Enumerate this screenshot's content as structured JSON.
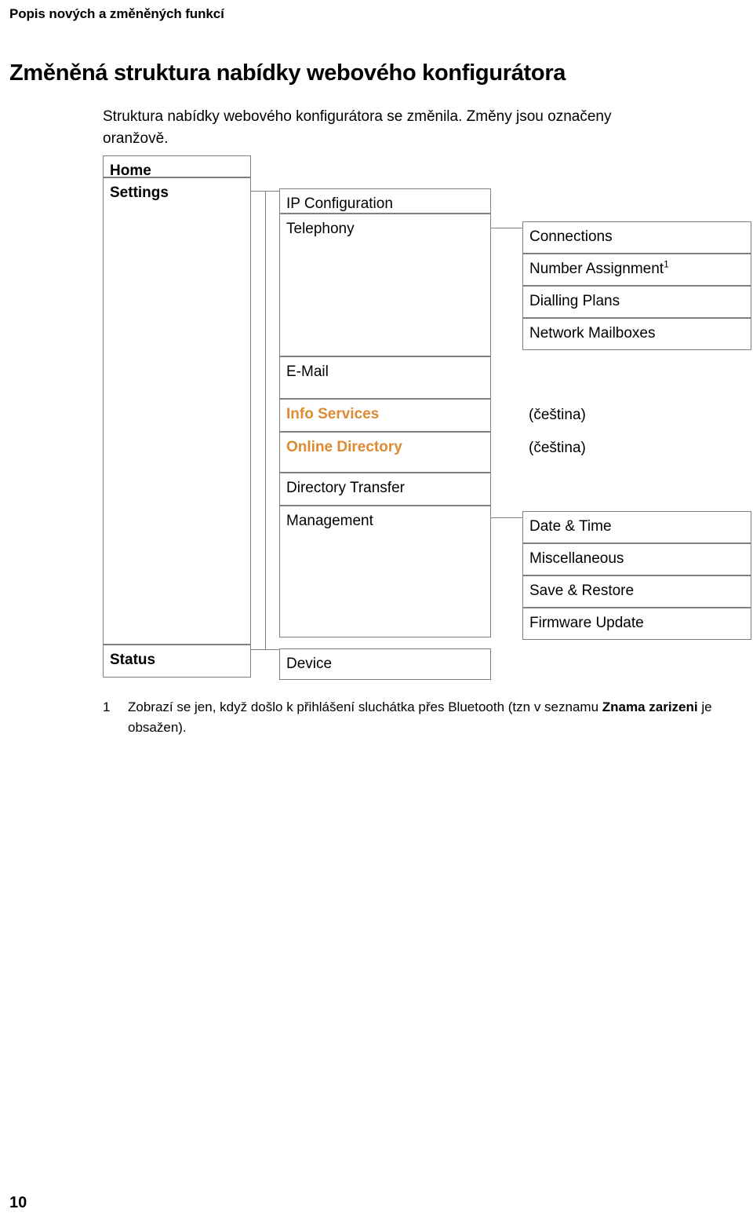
{
  "running_head": "Popis nových a změněných funkcí",
  "page_title": "Změněná struktura nabídky webového konfigurátora",
  "intro": "Struktura nabídky webového konfigurátora se změnila. Změny jsou označeny oranžově.",
  "colors": {
    "changed_accent": "#DD8A33",
    "box_border": "#808080",
    "text": "#000000"
  },
  "diagram": {
    "level1": [
      {
        "label": "Home"
      },
      {
        "label": "Settings"
      },
      {
        "label": "Status"
      }
    ],
    "level2": [
      {
        "label": "IP Configuration",
        "changed": false
      },
      {
        "label": "Telephony",
        "changed": false
      },
      {
        "label": "E-Mail",
        "changed": false
      },
      {
        "label": "Info Services",
        "changed": true
      },
      {
        "label": "Online Directory",
        "changed": true
      },
      {
        "label": "Directory Transfer",
        "changed": false
      },
      {
        "label": "Management",
        "changed": false
      },
      {
        "label": "Device",
        "changed": false
      }
    ],
    "level3": [
      {
        "label": "Connections",
        "footnote": ""
      },
      {
        "label": "Number Assignment",
        "footnote": "1"
      },
      {
        "label": "Dialling Plans",
        "footnote": ""
      },
      {
        "label": "Network Mailboxes",
        "footnote": ""
      },
      {
        "label": "Date & Time",
        "footnote": ""
      },
      {
        "label": "Miscellaneous",
        "footnote": ""
      },
      {
        "label": "Save & Restore",
        "footnote": ""
      },
      {
        "label": "Firmware Update",
        "footnote": ""
      }
    ],
    "annotations": [
      {
        "label": "(čeština)"
      },
      {
        "label": "(čeština)"
      }
    ]
  },
  "footnote": {
    "marker": "1",
    "text_part1": "Zobrazí se jen, když došlo k přihlášení sluchátka přes Bluetooth (tzn v seznamu ",
    "bold_part": "Znama zarizeni",
    "text_part2": " je obsažen)."
  },
  "folio": "10"
}
